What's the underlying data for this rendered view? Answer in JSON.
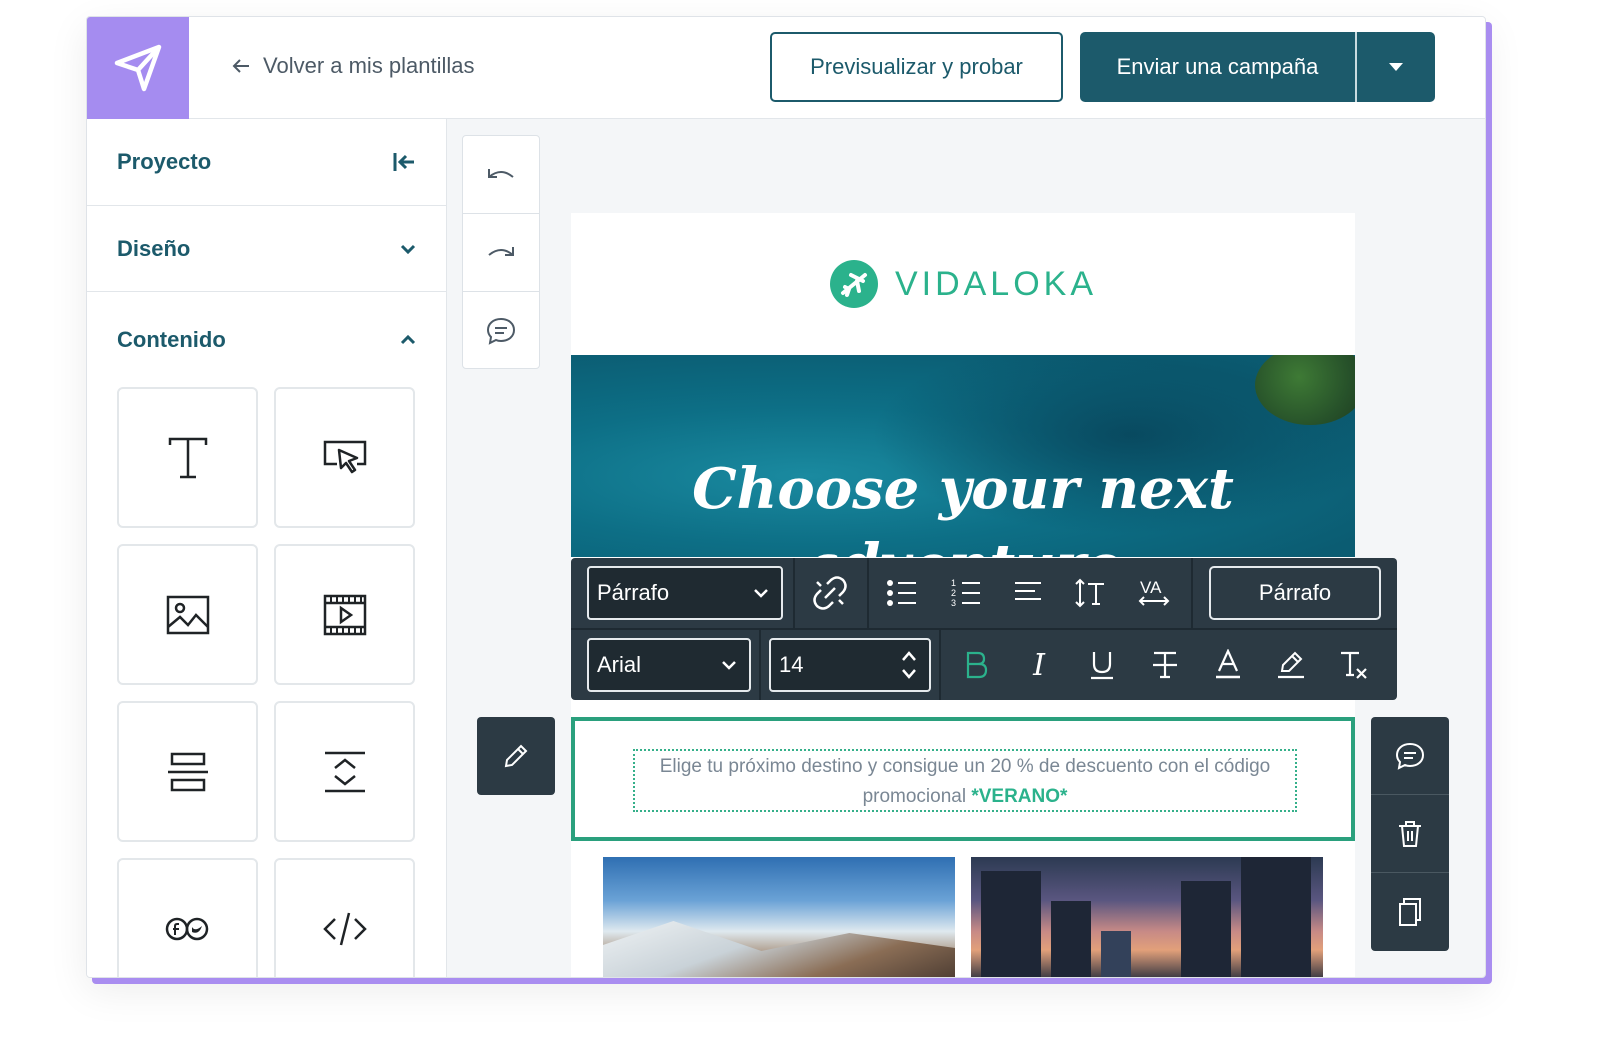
{
  "header": {
    "back_label": "Volver a mis plantillas",
    "preview_label": "Previsualizar y probar",
    "send_label": "Enviar una campaña"
  },
  "sidebar": {
    "project_label": "Proyecto",
    "design_label": "Diseño",
    "content_label": "Contenido",
    "blocks": [
      "text",
      "button",
      "image",
      "video",
      "divider",
      "spacer",
      "social",
      "html"
    ]
  },
  "email": {
    "brand_name": "VIDALOKA",
    "hero_title": "Choose your next adventure",
    "selected_text": "Elige tu próximo destino y consigue un 20 % de descuento con el código promocional ",
    "promo_code": "*VERANO*"
  },
  "toolbar": {
    "block_type": "Párrafo",
    "font_family": "Arial",
    "font_size": "14",
    "style_button": "Párrafo"
  },
  "colors": {
    "accent": "#1c5a6b",
    "brand_green": "#2bb28c",
    "logo_purple": "#a58cf0",
    "toolbar_dark": "#2c3a44"
  }
}
